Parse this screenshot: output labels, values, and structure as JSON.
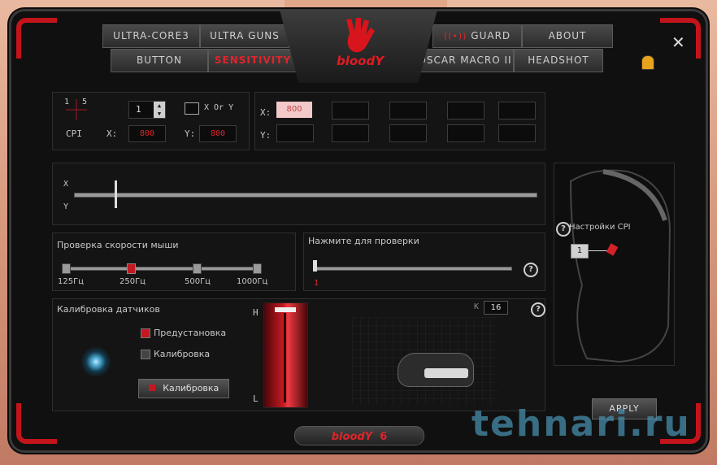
{
  "tabs": {
    "ultra_core3": "Ultra-Core3",
    "ultra_guns": "Ultra Guns",
    "button": "Button",
    "sensitivity": "Sensitivity",
    "guard": "Guard",
    "about": "About",
    "oscar_macro": "Oscar Macro II",
    "headshot": "Headshot"
  },
  "logo": {
    "text": "bloodY"
  },
  "cpi": {
    "cross_label": "5",
    "cross_label_left": "1",
    "cpi_label": "CPI",
    "level_value": "1",
    "x_or_y_label": "X Or Y",
    "x_label": "X:",
    "y_label": "Y:",
    "x_value": "800",
    "y_value": "800"
  },
  "cpi_grid": {
    "x_label": "X:",
    "y_label": "Y:",
    "first_value": "800"
  },
  "xy_slider": {
    "x_label": "X",
    "y_label": "Y"
  },
  "report_rate": {
    "title": "Проверка скорости мыши",
    "options": [
      "125Гц",
      "250Гц",
      "500Гц",
      "1000Гц"
    ],
    "selected_index": 1
  },
  "test": {
    "title": "Нажмите для проверки",
    "value": "1"
  },
  "calibration": {
    "title": "Калибровка датчиков",
    "preset_label": "Предустановка",
    "calib_label": "Калибровка",
    "button_label": "Калибровка",
    "h_label": "H",
    "l_label": "L"
  },
  "sensor_graph": {
    "k_label": "K",
    "k_value": "16"
  },
  "mouse_side": {
    "cpi_settings": "Настройки CPI",
    "cpi_level": "1"
  },
  "apply_label": "APPLY",
  "footer_brand": "bloodY",
  "footer_version": "6",
  "watermark": "tehnari.ru",
  "colors": {
    "accent": "#e0242b",
    "frame": "#c4141b",
    "bg": "#101010"
  }
}
